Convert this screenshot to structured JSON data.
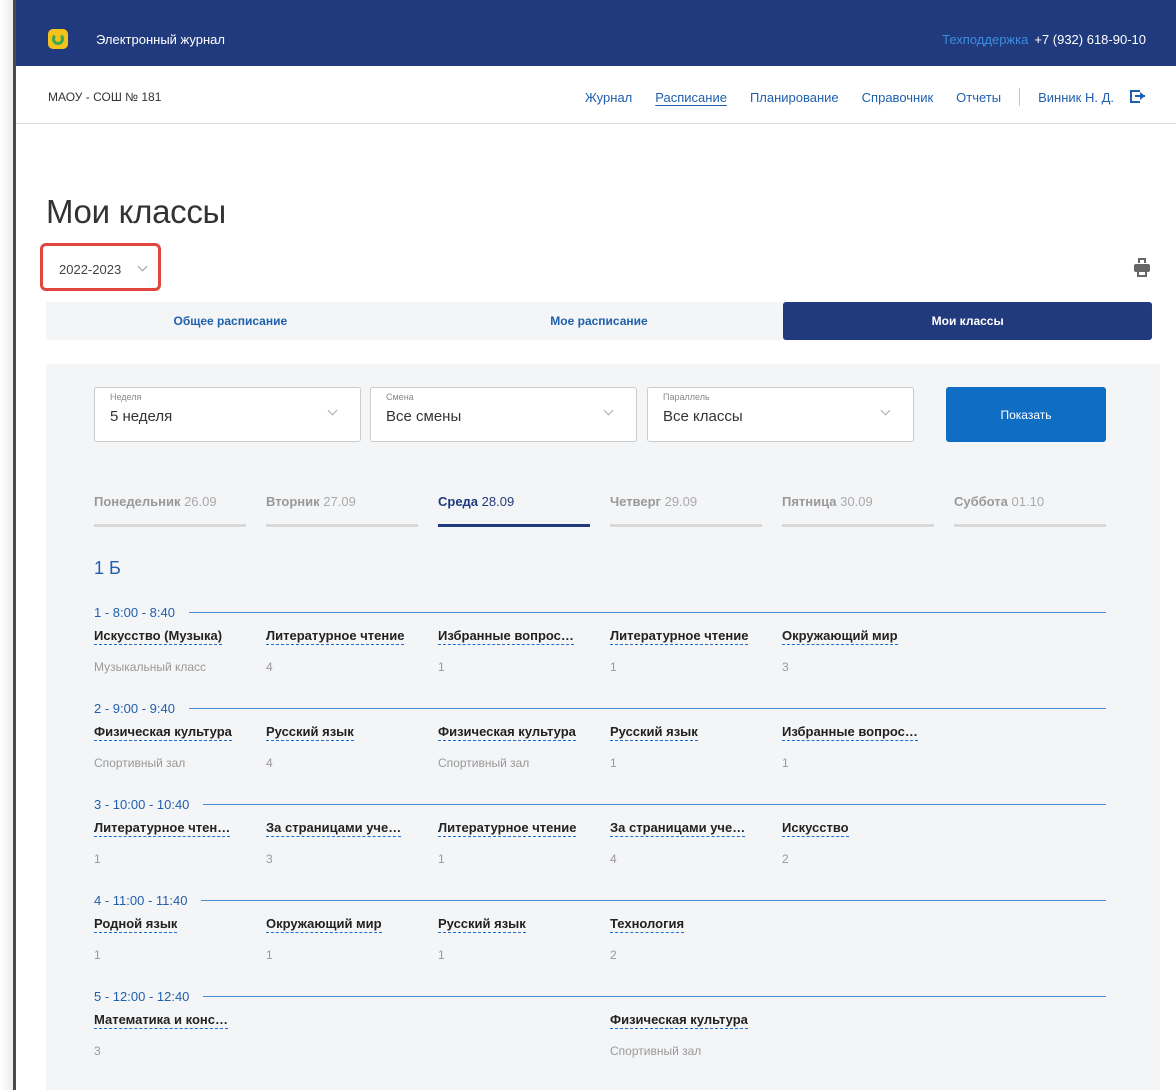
{
  "header": {
    "app_title": "Электронный журнал",
    "support_label": "Техподдержка",
    "support_phone": "+7 (932) 618-90-10"
  },
  "nav": {
    "school": "МАОУ - СОШ № 181",
    "links": [
      "Журнал",
      "Расписание",
      "Планирование",
      "Справочник",
      "Отчеты"
    ],
    "active": "Расписание",
    "user": "Винник Н. Д."
  },
  "page": {
    "title": "Мои классы",
    "year": "2022-2023"
  },
  "tabs": [
    "Общее расписание",
    "Мое расписание",
    "Мои классы"
  ],
  "active_tab": "Мои классы",
  "filters": {
    "week": {
      "label": "Неделя",
      "value": "5 неделя"
    },
    "shift": {
      "label": "Смена",
      "value": "Все смены"
    },
    "parallel": {
      "label": "Параллель",
      "value": "Все классы"
    },
    "show_button": "Показать"
  },
  "days": [
    {
      "name": "Понедельник",
      "date": "26.09"
    },
    {
      "name": "Вторник",
      "date": "27.09"
    },
    {
      "name": "Среда",
      "date": "28.09"
    },
    {
      "name": "Четверг",
      "date": "29.09"
    },
    {
      "name": "Пятница",
      "date": "30.09"
    },
    {
      "name": "Суббота",
      "date": "01.10"
    }
  ],
  "active_day": "Среда",
  "class_name": "1 Б",
  "lessons": [
    {
      "num": "1",
      "time": "8:00 - 8:40",
      "cells": [
        {
          "col": 0,
          "subject": "Искусство (Музыка)",
          "room": "Музыкальный класс"
        },
        {
          "col": 1,
          "subject": "Литературное чтение",
          "room": "4"
        },
        {
          "col": 2,
          "subject": "Избранные вопрос…",
          "room": "1"
        },
        {
          "col": 3,
          "subject": "Литературное чтение",
          "room": "1"
        },
        {
          "col": 4,
          "subject": "Окружающий мир",
          "room": "3"
        }
      ]
    },
    {
      "num": "2",
      "time": "9:00 - 9:40",
      "cells": [
        {
          "col": 0,
          "subject": "Физическая культура",
          "room": "Спортивный зал"
        },
        {
          "col": 1,
          "subject": "Русский язык",
          "room": "4"
        },
        {
          "col": 2,
          "subject": "Физическая культура",
          "room": "Спортивный зал"
        },
        {
          "col": 3,
          "subject": "Русский язык",
          "room": "1"
        },
        {
          "col": 4,
          "subject": "Избранные вопрос…",
          "room": "1"
        }
      ]
    },
    {
      "num": "3",
      "time": "10:00 - 10:40",
      "cells": [
        {
          "col": 0,
          "subject": "Литературное чтен…",
          "room": "1"
        },
        {
          "col": 1,
          "subject": "За страницами уче…",
          "room": "3"
        },
        {
          "col": 2,
          "subject": "Литературное чтение",
          "room": "1"
        },
        {
          "col": 3,
          "subject": "За страницами уче…",
          "room": "4"
        },
        {
          "col": 4,
          "subject": "Искусство",
          "room": "2"
        }
      ]
    },
    {
      "num": "4",
      "time": "11:00 - 11:40",
      "cells": [
        {
          "col": 0,
          "subject": "Родной язык",
          "room": "1"
        },
        {
          "col": 1,
          "subject": "Окружающий мир",
          "room": "1"
        },
        {
          "col": 2,
          "subject": "Русский язык",
          "room": "1"
        },
        {
          "col": 3,
          "subject": "Технология",
          "room": "2"
        }
      ]
    },
    {
      "num": "5",
      "time": "12:00 - 12:40",
      "cells": [
        {
          "col": 0,
          "subject": "Математика и конс…",
          "room": "3"
        },
        {
          "col": 3,
          "subject": "Физическая культура",
          "room": "Спортивный зал"
        }
      ]
    }
  ]
}
